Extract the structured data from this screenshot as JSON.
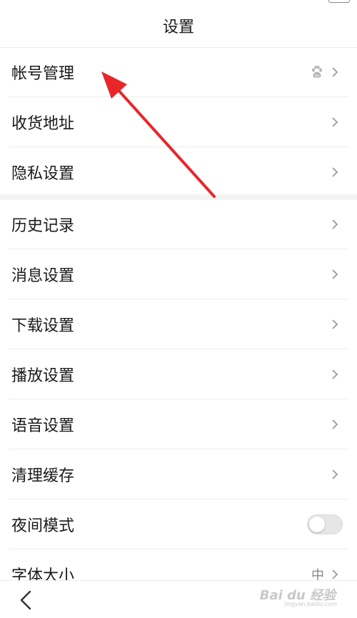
{
  "header": {
    "title": "设置"
  },
  "groups": [
    {
      "items": [
        {
          "label": "帐号管理",
          "right": "paw-chevron"
        },
        {
          "label": "收货地址",
          "right": "chevron"
        },
        {
          "label": "隐私设置",
          "right": "chevron"
        }
      ]
    },
    {
      "items": [
        {
          "label": "历史记录",
          "right": "chevron"
        },
        {
          "label": "消息设置",
          "right": "chevron"
        },
        {
          "label": "下载设置",
          "right": "chevron"
        },
        {
          "label": "播放设置",
          "right": "chevron"
        },
        {
          "label": "语音设置",
          "right": "chevron"
        },
        {
          "label": "清理缓存",
          "right": "chevron"
        },
        {
          "label": "夜间模式",
          "right": "toggle",
          "toggle_on": false
        },
        {
          "label": "字体大小",
          "right": "value-chevron",
          "value": "中"
        }
      ]
    }
  ],
  "icons": {
    "account_badge": "baidu-paw-icon",
    "chevron": "chevron-right-icon",
    "back": "chevron-left-icon"
  },
  "watermark": {
    "text": "Bai du 经验",
    "sub": "jingyan.baidu.com"
  },
  "colors": {
    "arrow": "#e8262a",
    "text": "#1a1a1a",
    "chevron": "#9a9a9a",
    "divider": "#eeeeee"
  }
}
